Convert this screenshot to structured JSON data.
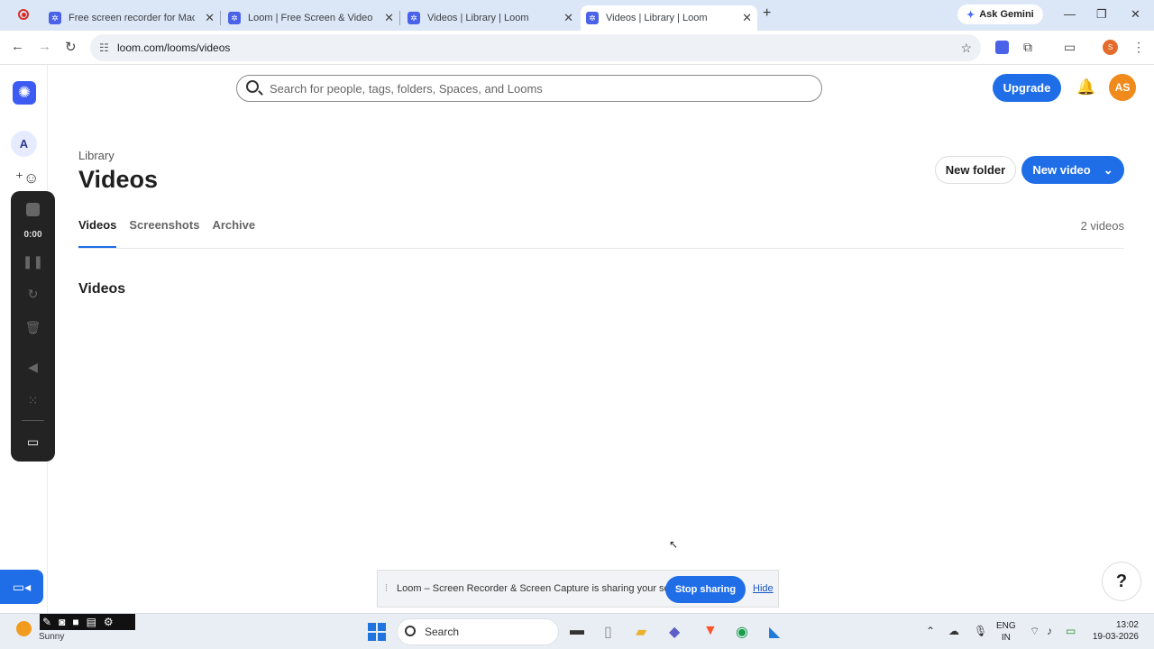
{
  "browser": {
    "tabs": [
      {
        "title": "Free screen recorder for Mac and PC | Loom"
      },
      {
        "title": "Loom | Free Screen & Video Recording Software"
      },
      {
        "title": "Videos | Library | Loom"
      },
      {
        "title": "Videos | Library | Loom"
      }
    ],
    "active_tab_index": 3,
    "ask_gemini": "Ask Gemini",
    "url": "loom.com/looms/videos",
    "profile_initial": "S"
  },
  "app": {
    "search_placeholder": "Search for people, tags, folders, Spaces, and Looms",
    "upgrade_label": "Upgrade",
    "avatar_initials": "AS",
    "workspace_initial": "A",
    "breadcrumb": "Library",
    "page_title": "Videos",
    "new_folder_label": "New folder",
    "new_video_label": "New video",
    "tabs": [
      {
        "label": "Videos",
        "active": true
      },
      {
        "label": "Screenshots",
        "active": false
      },
      {
        "label": "Archive",
        "active": false
      }
    ],
    "video_count": "2 videos",
    "section_title": "Videos",
    "help_label": "?"
  },
  "recorder": {
    "timer": "0:00"
  },
  "share_bar": {
    "message": "Loom – Screen Recorder & Screen Capture is sharing your screen.",
    "stop_label": "Stop sharing",
    "hide_label": "Hide"
  },
  "taskbar": {
    "weather": "Sunny",
    "search_label": "Search",
    "lang_line1": "ENG",
    "lang_line2": "IN",
    "time": "13:02",
    "date": "19-03-2026"
  },
  "colors": {
    "accent": "#1f6ee8",
    "loom_brand": "#3b5bf2",
    "avatar": "#f08a1c"
  }
}
